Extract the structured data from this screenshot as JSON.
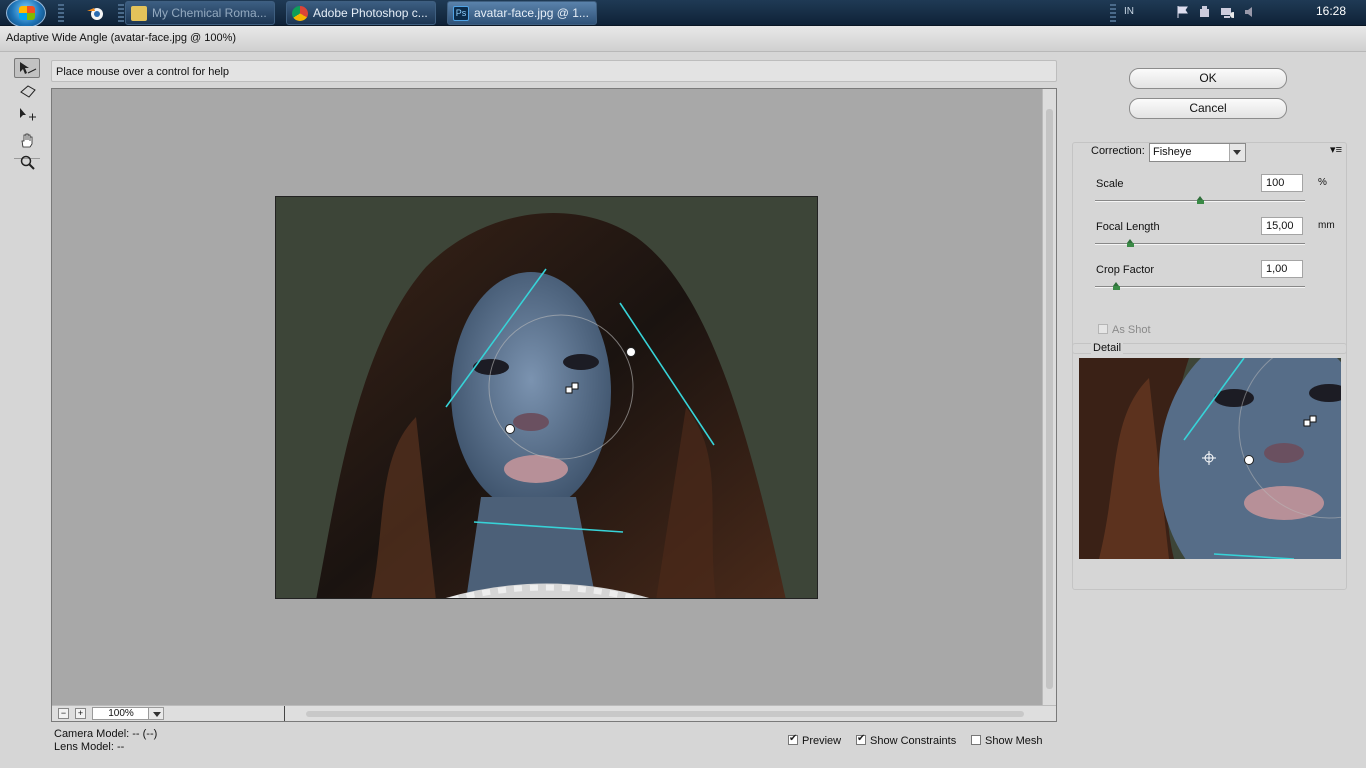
{
  "taskbar": {
    "windows": [
      {
        "label": "My Chemical Roma..."
      },
      {
        "label": "Adobe Photoshop c..."
      },
      {
        "label": "avatar-face.jpg @ 1..."
      }
    ],
    "language": "IN",
    "clock": "16:28"
  },
  "dialog": {
    "title": "Adaptive Wide Angle (avatar-face.jpg @ 100%)",
    "help_text": "Place mouse over a control for help",
    "zoom": "100%",
    "zoom_minus": "−",
    "zoom_plus": "+",
    "status": {
      "camera_model": "Camera Model: -- (--)",
      "lens_model": "Lens Model: --"
    },
    "checkboxes": [
      {
        "label": "Preview",
        "checked": true
      },
      {
        "label": "Show Constraints",
        "checked": true
      },
      {
        "label": "Show Mesh",
        "checked": false
      }
    ],
    "buttons": {
      "ok": "OK",
      "cancel": "Cancel"
    },
    "correction": {
      "label": "Correction:",
      "value": "Fisheye",
      "menu_icon": "▾≡",
      "params": [
        {
          "label": "Scale",
          "value": "100",
          "unit": "%",
          "slider_fraction": 0.5
        },
        {
          "label": "Focal Length",
          "value": "15,00",
          "unit": "mm",
          "slider_fraction": 0.17
        },
        {
          "label": "Crop Factor",
          "value": "1,00",
          "unit": "",
          "slider_fraction": 0.1
        }
      ],
      "as_shot": "As Shot"
    },
    "detail_label": "Detail"
  },
  "colors": {
    "constraint_line": "#37d3d8",
    "canvas_bg": "#a8a8a8"
  }
}
